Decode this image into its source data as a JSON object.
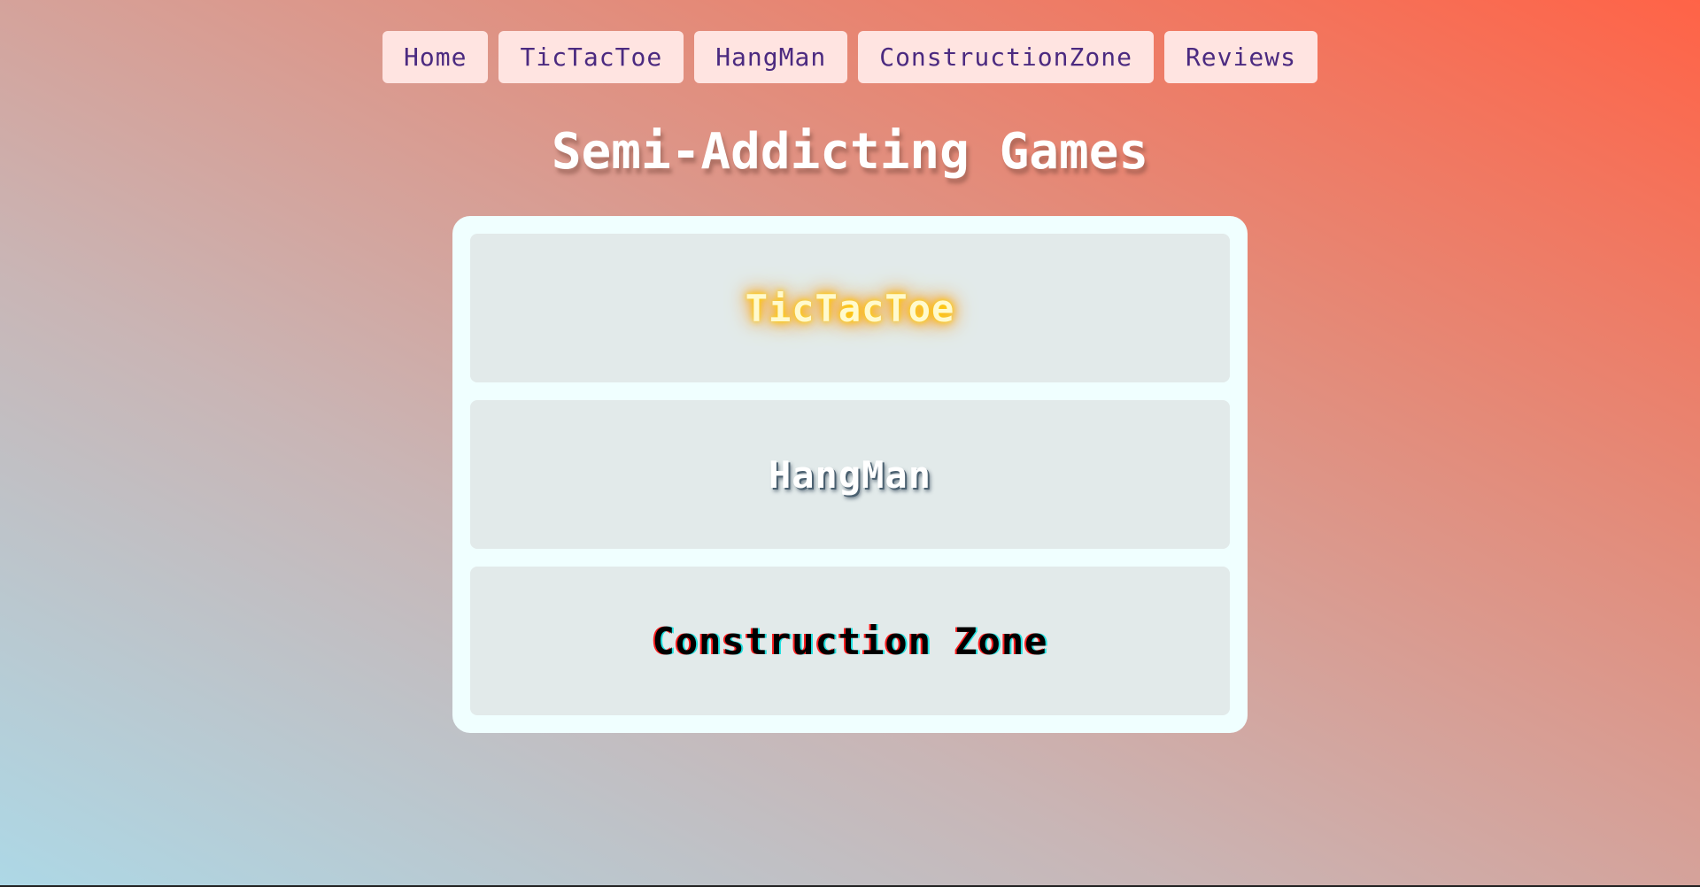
{
  "nav": {
    "items": [
      {
        "label": "Home"
      },
      {
        "label": "TicTacToe"
      },
      {
        "label": "HangMan"
      },
      {
        "label": "ConstructionZone"
      },
      {
        "label": "Reviews"
      }
    ]
  },
  "page": {
    "title": "Semi-Addicting Games"
  },
  "games": [
    {
      "label": "TicTacToe"
    },
    {
      "label": "HangMan"
    },
    {
      "label": "Construction Zone"
    }
  ],
  "colors": {
    "nav_button_bg": "#ffe4e1",
    "nav_button_text": "#4b2a80",
    "panel_bg": "#f0ffff",
    "card_bg": "#e2eaea",
    "gradient_start": "#add8e6",
    "gradient_end": "#ff6347"
  }
}
